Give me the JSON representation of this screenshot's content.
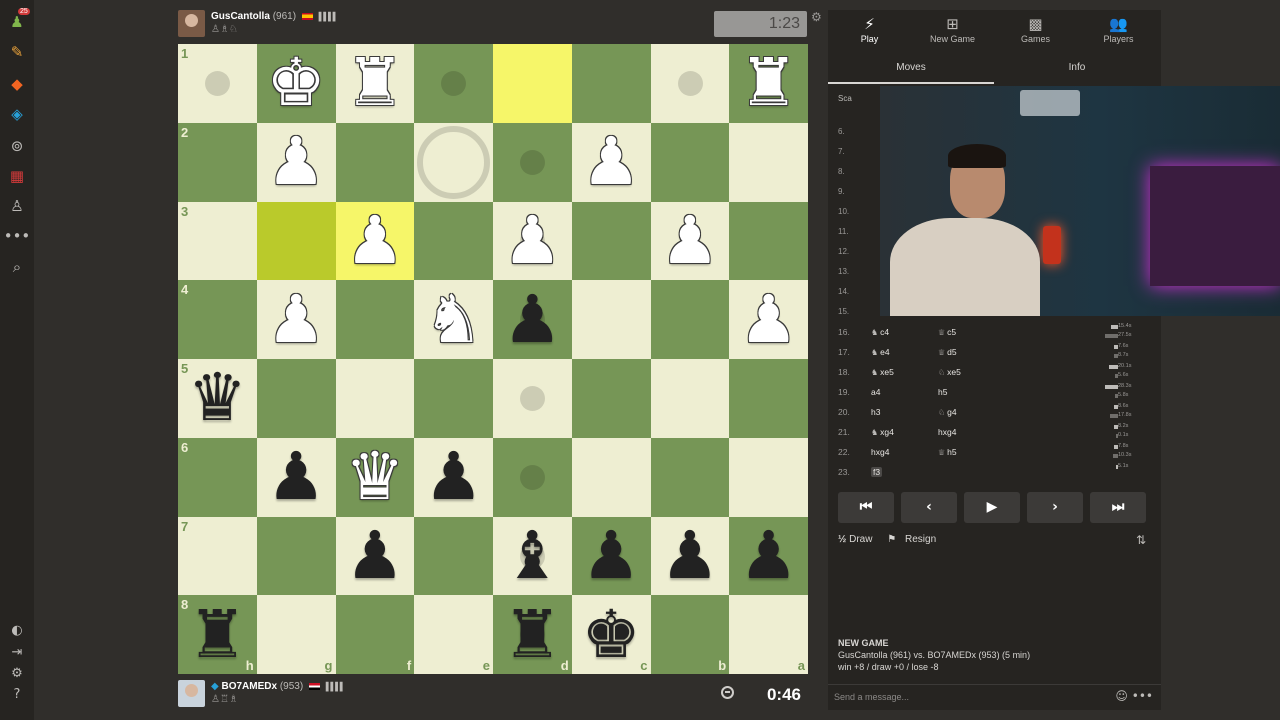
{
  "nav": {
    "icons": [
      {
        "name": "play-icon",
        "glyph": "♟",
        "color": "#81b64c"
      },
      {
        "name": "puzzles-icon",
        "glyph": "✎",
        "color": "#e9a23b"
      },
      {
        "name": "learn-icon",
        "glyph": "◆",
        "color": "#f26522"
      },
      {
        "name": "watch-icon",
        "glyph": "◈",
        "color": "#27a0d8"
      },
      {
        "name": "explore-icon",
        "glyph": "⊚",
        "color": "#bdbbb8"
      },
      {
        "name": "news-icon",
        "glyph": "▦",
        "color": "#d23a3a"
      },
      {
        "name": "social-icon",
        "glyph": "♙",
        "color": "#bdbbb8"
      },
      {
        "name": "more-icon",
        "glyph": "•••",
        "color": "#bdbbb8"
      },
      {
        "name": "search-icon",
        "glyph": "⌕",
        "color": "#bdbbb8"
      }
    ],
    "bottom_icons": [
      {
        "name": "theme-icon",
        "glyph": "◐"
      },
      {
        "name": "collapse-icon",
        "glyph": "⇥"
      },
      {
        "name": "settings-icon",
        "glyph": "⚙"
      },
      {
        "name": "help-icon",
        "glyph": "?"
      }
    ],
    "badge": "25"
  },
  "top_player": {
    "name": "GusCantolla",
    "rating": "(961)",
    "captured": "♙♗♘",
    "clock": "1:23",
    "flag_color": "#c60b1e"
  },
  "bottom_player": {
    "name": "BO7AMEDx",
    "rating": "(953)",
    "captured": "♙♖♗",
    "clock": "0:46",
    "flag_color": "#ce1126"
  },
  "board": {
    "ranks": [
      "1",
      "2",
      "3",
      "4",
      "5",
      "6",
      "7",
      "8"
    ],
    "files": [
      "h",
      "g",
      "f",
      "e",
      "d",
      "c",
      "b",
      "a"
    ],
    "highlight": [
      [
        2,
        1
      ],
      [
        2,
        2
      ],
      [
        0,
        4
      ]
    ],
    "dots": [
      [
        0,
        0
      ],
      [
        0,
        1
      ],
      [
        0,
        2
      ],
      [
        0,
        3
      ],
      [
        0,
        6
      ],
      [
        1,
        4
      ],
      [
        2,
        4
      ],
      [
        3,
        4
      ],
      [
        4,
        4
      ],
      [
        5,
        4
      ],
      [
        6,
        4
      ],
      [
        7,
        4
      ]
    ],
    "rings": [
      [
        1,
        3
      ]
    ],
    "pieces": [
      {
        "row": 0,
        "col": 1,
        "glyph": "♚",
        "color": "w"
      },
      {
        "row": 0,
        "col": 2,
        "glyph": "♜",
        "color": "w"
      },
      {
        "row": 0,
        "col": 7,
        "glyph": "♜",
        "color": "w"
      },
      {
        "row": 1,
        "col": 1,
        "glyph": "♟",
        "color": "w"
      },
      {
        "row": 1,
        "col": 5,
        "glyph": "♟",
        "color": "w"
      },
      {
        "row": 2,
        "col": 2,
        "glyph": "♟",
        "color": "w"
      },
      {
        "row": 2,
        "col": 4,
        "glyph": "♟",
        "color": "w"
      },
      {
        "row": 2,
        "col": 6,
        "glyph": "♟",
        "color": "w"
      },
      {
        "row": 3,
        "col": 1,
        "glyph": "♟",
        "color": "w"
      },
      {
        "row": 3,
        "col": 3,
        "glyph": "♞",
        "color": "w"
      },
      {
        "row": 3,
        "col": 4,
        "glyph": "♟",
        "color": "b"
      },
      {
        "row": 3,
        "col": 7,
        "glyph": "♟",
        "color": "w"
      },
      {
        "row": 4,
        "col": 0,
        "glyph": "♛",
        "color": "b"
      },
      {
        "row": 5,
        "col": 1,
        "glyph": "♟",
        "color": "b"
      },
      {
        "row": 5,
        "col": 2,
        "glyph": "♛",
        "color": "w"
      },
      {
        "row": 5,
        "col": 3,
        "glyph": "♟",
        "color": "b"
      },
      {
        "row": 6,
        "col": 2,
        "glyph": "♟",
        "color": "b"
      },
      {
        "row": 6,
        "col": 4,
        "glyph": "♝",
        "color": "b"
      },
      {
        "row": 6,
        "col": 5,
        "glyph": "♟",
        "color": "b"
      },
      {
        "row": 6,
        "col": 6,
        "glyph": "♟",
        "color": "b"
      },
      {
        "row": 6,
        "col": 7,
        "glyph": "♟",
        "color": "b"
      },
      {
        "row": 7,
        "col": 0,
        "glyph": "♜",
        "color": "b"
      },
      {
        "row": 7,
        "col": 4,
        "glyph": "♜",
        "color": "b"
      },
      {
        "row": 7,
        "col": 5,
        "glyph": "♚",
        "color": "b"
      }
    ]
  },
  "panel": {
    "tabs": [
      {
        "label": "Play",
        "icon": "⚡",
        "active": true
      },
      {
        "label": "New Game",
        "icon": "⊞",
        "active": false
      },
      {
        "label": "Games",
        "icon": "▩",
        "active": false
      },
      {
        "label": "Players",
        "icon": "👥",
        "active": false
      }
    ],
    "subtabs": [
      "Moves",
      "Info"
    ],
    "scan_label": "Sca",
    "hidden_move_numbers": [
      "6.",
      "7.",
      "8.",
      "9.",
      "10.",
      "11.",
      "12.",
      "13.",
      "14.",
      "15."
    ],
    "moves": [
      {
        "n": "16.",
        "w_icon": "♞",
        "w": "c4",
        "b_icon": "♕",
        "b": "c5",
        "tw": "15.4s",
        "tb": "27.5s"
      },
      {
        "n": "17.",
        "w_icon": "♞",
        "w": "e4",
        "b_icon": "♕",
        "b": "d5",
        "tw": "7.6s",
        "tb": "8.7s"
      },
      {
        "n": "18.",
        "w_icon": "♞",
        "w": "xe5",
        "b_icon": "♘",
        "b": "xe5",
        "tw": "20.1s",
        "tb": "5.6s"
      },
      {
        "n": "19.",
        "w_icon": "",
        "w": "a4",
        "b_icon": "",
        "b": "h5",
        "tw": "28.3s",
        "tb": "5.8s"
      },
      {
        "n": "20.",
        "w_icon": "",
        "w": "h3",
        "b_icon": "♘",
        "b": "g4",
        "tw": "8.6s",
        "tb": "17.8s"
      },
      {
        "n": "21.",
        "w_icon": "♞",
        "w": "xg4",
        "b_icon": "",
        "b": "hxg4",
        "tw": "8.2s",
        "tb": "0.1s"
      },
      {
        "n": "22.",
        "w_icon": "",
        "w": "hxg4",
        "b_icon": "♕",
        "b": "h5",
        "tw": "7.8s",
        "tb": "10.3s"
      },
      {
        "n": "23.",
        "w_icon": "",
        "w": "f3",
        "b_icon": "",
        "b": "",
        "tw": "5.1s",
        "tb": ""
      }
    ],
    "time_values": [
      {
        "w": 15.4,
        "b": 27.5
      },
      {
        "w": 7.6,
        "b": 8.7
      },
      {
        "w": 20.1,
        "b": 5.6
      },
      {
        "w": 28.3,
        "b": 5.8
      },
      {
        "w": 8.6,
        "b": 17.8
      },
      {
        "w": 8.2,
        "b": 0.1
      },
      {
        "w": 7.8,
        "b": 10.3
      },
      {
        "w": 5.1,
        "b": 0
      }
    ],
    "nav_buttons": [
      {
        "name": "first-move-button",
        "glyph": "⏮"
      },
      {
        "name": "prev-move-button",
        "glyph": "‹"
      },
      {
        "name": "play-moves-button",
        "glyph": "▶"
      },
      {
        "name": "next-move-button",
        "glyph": "›"
      },
      {
        "name": "last-move-button",
        "glyph": "⏭"
      }
    ],
    "draw_label": "Draw",
    "draw_icon": "½",
    "resign_label": "Resign",
    "resign_icon": "⚑",
    "flip_icon": "⇅",
    "new_game_title": "NEW GAME",
    "new_game_players": "GusCantolla (961) vs. BO7AMEDx (953) (5 min)",
    "new_game_stakes": "win +8 / draw +0 / lose -8",
    "message_placeholder": "Send a message...",
    "emoji_icon": "☺",
    "more_icon": "•••"
  }
}
